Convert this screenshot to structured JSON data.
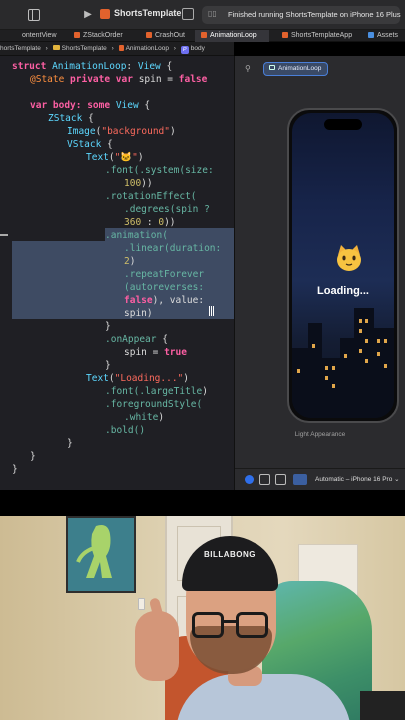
{
  "toolbar": {
    "scheme": "ShortsTemplate",
    "status": "Finished running ShortsTemplate on iPhone 16 Plus",
    "icons": [
      "sidebar-toggle-icon",
      "play-icon",
      "app-icon",
      "device-icon"
    ]
  },
  "tabs": [
    {
      "label": "ontentView",
      "active": false
    },
    {
      "label": "ZStackOrder",
      "active": false
    },
    {
      "label": "CrashOut",
      "active": false
    },
    {
      "label": "AnimationLoop",
      "active": true
    },
    {
      "label": "ShortsTemplateApp",
      "active": false
    },
    {
      "label": "Assets",
      "active": false
    }
  ],
  "breadcrumb": [
    "hortsTemplate",
    "ShortsTemplate",
    "AnimationLoop",
    "body"
  ],
  "code": {
    "l1a": "struct",
    "l1b": "AnimationLoop",
    "l1c": ": ",
    "l1d": "View",
    "l1e": " {",
    "l2a": "@State",
    "l2b": " private var ",
    "l2c": "spin",
    "l2d": " = ",
    "l2e": "false",
    "l4a": "var",
    "l4b": " body: some ",
    "l4c": "View",
    "l4d": " {",
    "l5a": "ZStack",
    "l5b": " {",
    "l6a": "Image",
    "l6b": "(",
    "l6c": "\"background\"",
    "l6d": ")",
    "l7a": "VStack",
    "l7b": " {",
    "l8a": "Text",
    "l8b": "(",
    "l8c": "\"🐱\"",
    "l8d": ")",
    "l9a": ".font(",
    "l9b": ".system(size:",
    "l10a": "100",
    "l10b": "))",
    "l11a": ".rotationEffect(",
    "l12a": ".degrees(spin ?",
    "l13a": "360",
    "l13b": " : ",
    "l13c": "0",
    "l13d": "))",
    "l14a": ".animation(",
    "l15a": ".linear(duration:",
    "l16a": "2",
    "l16b": ")",
    "l17a": ".repeatForever",
    "l18a": "(autoreverses:",
    "l19a": "false",
    "l19b": "), value:",
    "l20a": "spin",
    "l20b": ")",
    "l21a": "}",
    "l22a": ".onAppear",
    "l22b": " {",
    "l23a": "spin",
    "l23b": " = ",
    "l23c": "true",
    "l24a": "}",
    "l25a": "Text",
    "l25b": "(",
    "l25c": "\"Loading...\"",
    "l25d": ")",
    "l26a": ".font(",
    "l26b": ".largeTitle",
    "l26c": ")",
    "l27a": ".foregroundStyle(",
    "l28a": ".white",
    "l28b": ")",
    "l29a": ".bold()",
    "l30a": "}",
    "l31a": "}",
    "l32a": "}"
  },
  "canvas": {
    "chip": "AnimationLoop",
    "preview_emoji": "🐱",
    "preview_text": "Loading...",
    "appearance_label": "Light Appearance",
    "device_selector": "Automatic – iPhone 16 Pro ⌄"
  },
  "webcam": {
    "cap_text": "BILLABONG"
  },
  "colors": {
    "keyword": "#fc5fa3",
    "type": "#5dd8ff",
    "string": "#fc6a5d",
    "number": "#d0bf69",
    "selection": "#3e4b63",
    "accent": "#2f6feb"
  }
}
